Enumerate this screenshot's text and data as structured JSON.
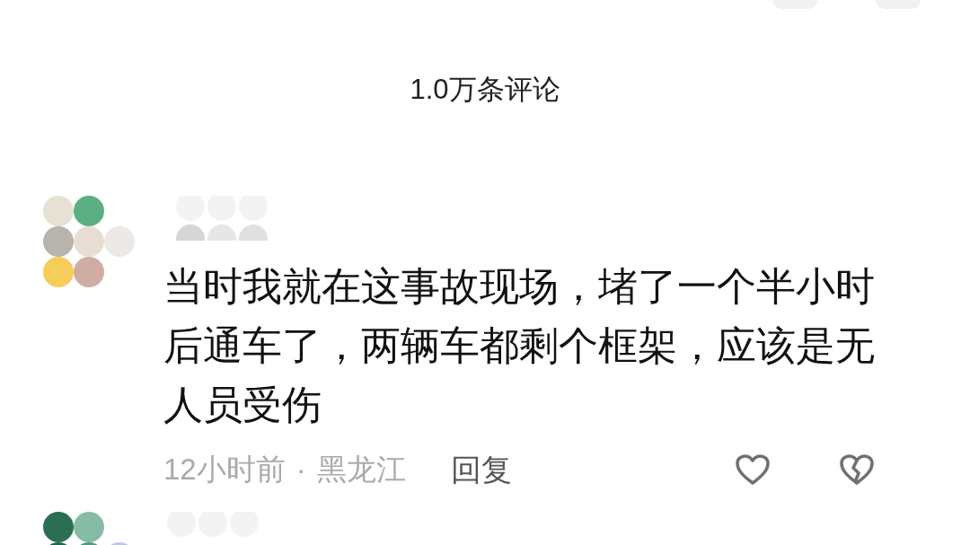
{
  "header": {
    "title": "1.0万条评论"
  },
  "comments": [
    {
      "kind": "full",
      "text": "当时我就在这事故现场，堵了一个半小时后通车了，两辆车都剩个框架，应该是无人员受伤",
      "time": "12小时前",
      "separator": "·",
      "location": "黑龙江",
      "reply": "回复"
    },
    {
      "kind": "cut"
    }
  ]
}
